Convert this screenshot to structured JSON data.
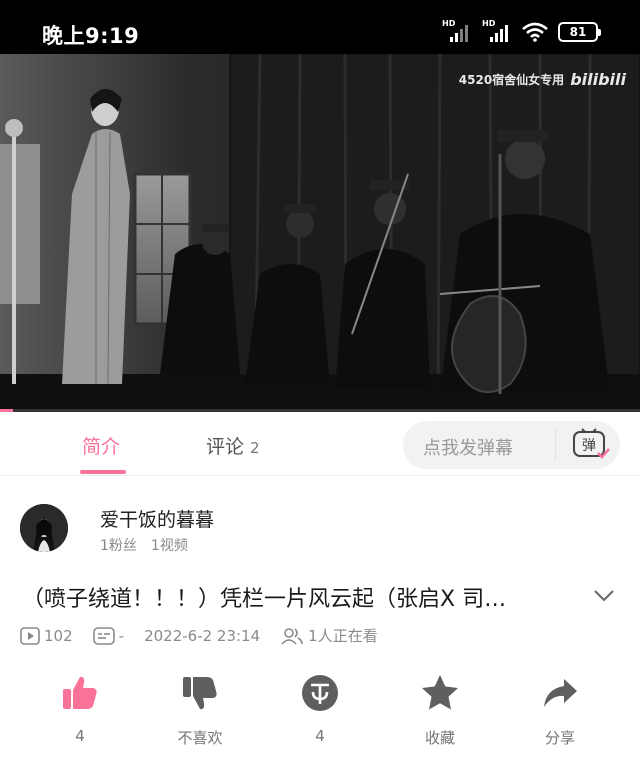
{
  "status_bar": {
    "time": "晚上9:19",
    "signal_1_label": "HD",
    "signal_2_label": "HD",
    "battery": "81"
  },
  "video": {
    "watermark_text": "4520宿舍仙女专用",
    "watermark_logo": "bilibili",
    "progress": 0.02
  },
  "tabs": {
    "intro_label": "简介",
    "comments_label": "评论",
    "comments_count": "2",
    "danmaku_placeholder": "点我发弹幕",
    "danmaku_icon_char": "弹"
  },
  "uploader": {
    "name": "爱干饭的暮暮",
    "fans": "1粉丝",
    "videos": "1视频"
  },
  "video_info": {
    "title": "（喷子绕道！！！）凭栏一片风云起（张启X 司…",
    "plays": "102",
    "danmaku_count": "-",
    "datetime": "2022-6-2 23:14",
    "watching": "1人正在看"
  },
  "actions": {
    "like_count": "4",
    "dislike_label": "不喜欢",
    "coin_count": "4",
    "favorite_label": "收藏",
    "share_label": "分享"
  },
  "colors": {
    "accent": "#fb7299",
    "icon_gray": "#5f5f5f"
  }
}
